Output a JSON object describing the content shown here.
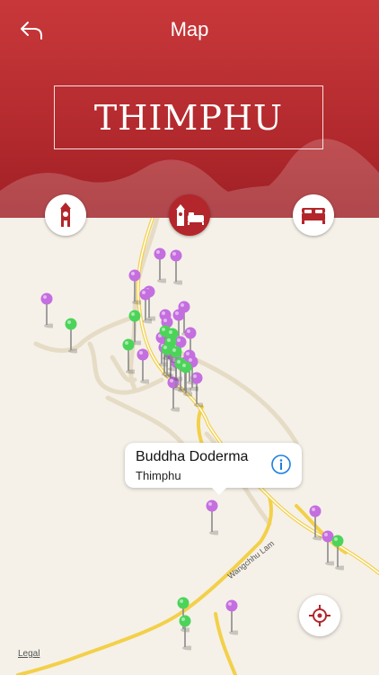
{
  "header": {
    "title": "Map",
    "city": "THIMPHU",
    "accent": "#b3262b"
  },
  "categories": [
    {
      "id": "sights",
      "icon": "clock-tower-icon",
      "active": false
    },
    {
      "id": "all",
      "icon": "tower-and-bed-icon",
      "active": true
    },
    {
      "id": "hotels",
      "icon": "bed-icon",
      "active": false
    }
  ],
  "map": {
    "road_labels": [
      "Wangchhu Lam"
    ],
    "legal": "Legal",
    "pin_colors": {
      "sight": "#c46ee0",
      "hotel": "#4cd45a"
    },
    "pins": [
      {
        "type": "sight",
        "count": 26
      },
      {
        "type": "hotel",
        "count": 13
      }
    ]
  },
  "callout": {
    "name": "Buddha Doderma",
    "subtitle": "Thimphu"
  }
}
